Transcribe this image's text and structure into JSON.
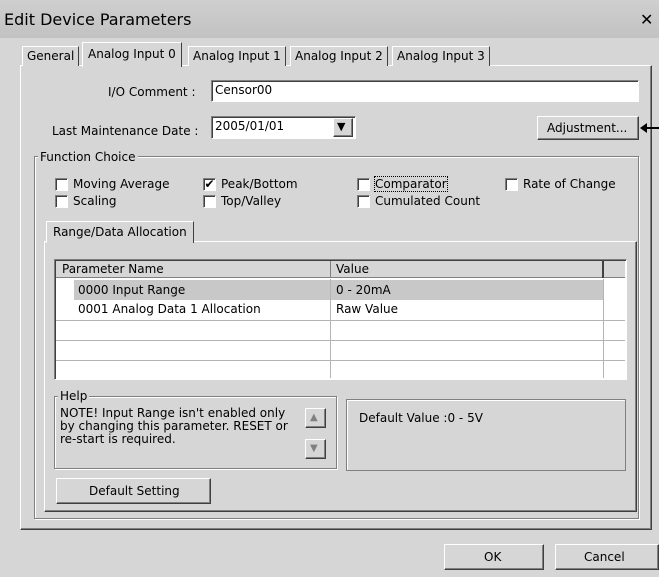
{
  "window": {
    "title": "Edit Device Parameters",
    "close": "✕"
  },
  "tabs": [
    "General",
    "Analog Input 0",
    "Analog Input 1",
    "Analog Input 2",
    "Analog Input 3"
  ],
  "io_comment": {
    "label": "I/O Comment :",
    "value": "Censor00"
  },
  "maintenance": {
    "label": "Last Maintenance Date :",
    "value": "2005/01/01",
    "arrow": "▼"
  },
  "adjustment_button": "Adjustment...",
  "function_choice": {
    "title": "Function Choice",
    "options": [
      {
        "label": "Moving Average",
        "checked": false
      },
      {
        "label": "Peak/Bottom",
        "checked": true
      },
      {
        "label": "Comparator",
        "checked": false
      },
      {
        "label": "Rate of Change",
        "checked": false
      },
      {
        "label": "Scaling",
        "checked": false
      },
      {
        "label": "Top/Valley",
        "checked": false
      },
      {
        "label": "Cumulated Count",
        "checked": false
      }
    ],
    "check_mark": "✔"
  },
  "inner_tab": "Range/Data Allocation",
  "table": {
    "headers": [
      "Parameter Name",
      "Value"
    ],
    "rows": [
      [
        "0000 Input Range",
        "0 - 20mA"
      ],
      [
        "0001 Analog Data 1 Allocation",
        "Raw Value"
      ]
    ]
  },
  "help": {
    "title": "Help",
    "note": "NOTE! Input Range isn't enabled only by changing this parameter. RESET or re-start is required.",
    "up": "▲",
    "down": "▼",
    "default_value": "Default Value :0 - 5V"
  },
  "default_setting_button": "Default Setting",
  "ok_button": "OK",
  "cancel_button": "Cancel"
}
